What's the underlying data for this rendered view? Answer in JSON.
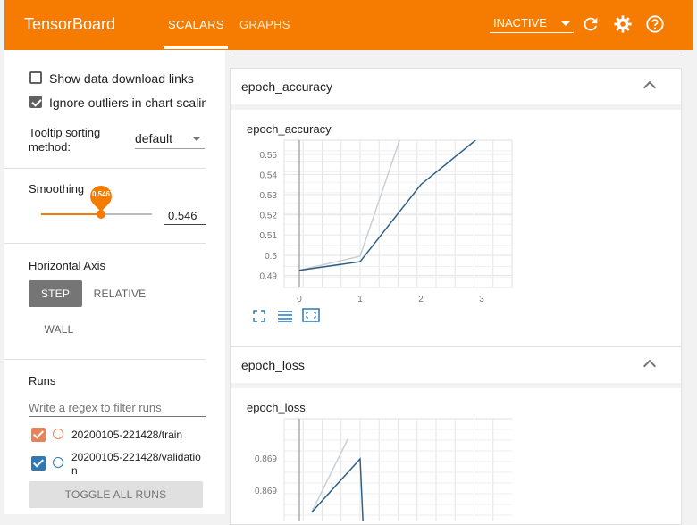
{
  "topbar": {
    "brand": "TensorBoard",
    "tabs": [
      {
        "label": "SCALARS"
      },
      {
        "label": "GRAPHS"
      }
    ],
    "run_status": "INACTIVE",
    "icons": [
      "refresh-icon",
      "settings-icon",
      "help-icon"
    ]
  },
  "sidebar": {
    "show_download_label": "Show data download links",
    "ignore_outliers_label": "Ignore outliers in chart scaling",
    "tooltip_sorting_label_line1": "Tooltip sorting",
    "tooltip_sorting_label_line2": "method:",
    "tooltip_sorting_value": "default",
    "smoothing_label": "Smoothing",
    "smoothing_value": "0.546",
    "smoothing_input": "0.546",
    "horizontal_axis_label": "Horizontal Axis",
    "axis_options": {
      "step": "STEP",
      "relative": "RELATIVE",
      "wall": "WALL"
    },
    "runs_label": "Runs",
    "runs_filter_placeholder": "Write a regex to filter runs",
    "runs": [
      {
        "name": "20200105-221428/train",
        "color": "#e8825a"
      },
      {
        "name_line1": "20200105-221428/validatio",
        "name_line2": "n",
        "color": "#2f78b4"
      }
    ],
    "toggle_all_label": "TOGGLE ALL RUNS"
  },
  "cards": [
    {
      "header": "epoch_accuracy",
      "chart_title": "epoch_accuracy"
    },
    {
      "header": "epoch_loss",
      "chart_title": "epoch_loss"
    }
  ],
  "chart_data": [
    {
      "type": "line",
      "title": "epoch_accuracy",
      "x_ticks": [
        "0",
        "1",
        "2",
        "3"
      ],
      "y_ticks": [
        "0.55",
        "0.54",
        "0.53",
        "0.52",
        "0.51",
        "0.5",
        "0.49"
      ],
      "xlim": [
        -0.25,
        3.5
      ],
      "ylim": [
        0.484,
        0.557
      ],
      "series": [
        {
          "color": "#2f5f85",
          "x": [
            0,
            1,
            2,
            2.9
          ],
          "y": [
            0.4925,
            0.4968,
            0.535,
            0.557
          ]
        },
        {
          "color": "#c9cfd6",
          "x": [
            0,
            1,
            1.65
          ],
          "y": [
            0.4925,
            0.4995,
            0.557
          ]
        }
      ]
    },
    {
      "type": "line",
      "title": "epoch_loss",
      "y_ticks": [
        "0.869",
        "0.869"
      ],
      "series": [
        {
          "color": "#2f5f85",
          "x": [
            0.2,
            1,
            1.05
          ],
          "y": [
            0.8692,
            0.87,
            0.869
          ]
        },
        {
          "color": "#c9cfd6",
          "x": [
            0.2,
            0.8
          ],
          "y": [
            0.8692,
            0.8703
          ]
        }
      ]
    }
  ]
}
